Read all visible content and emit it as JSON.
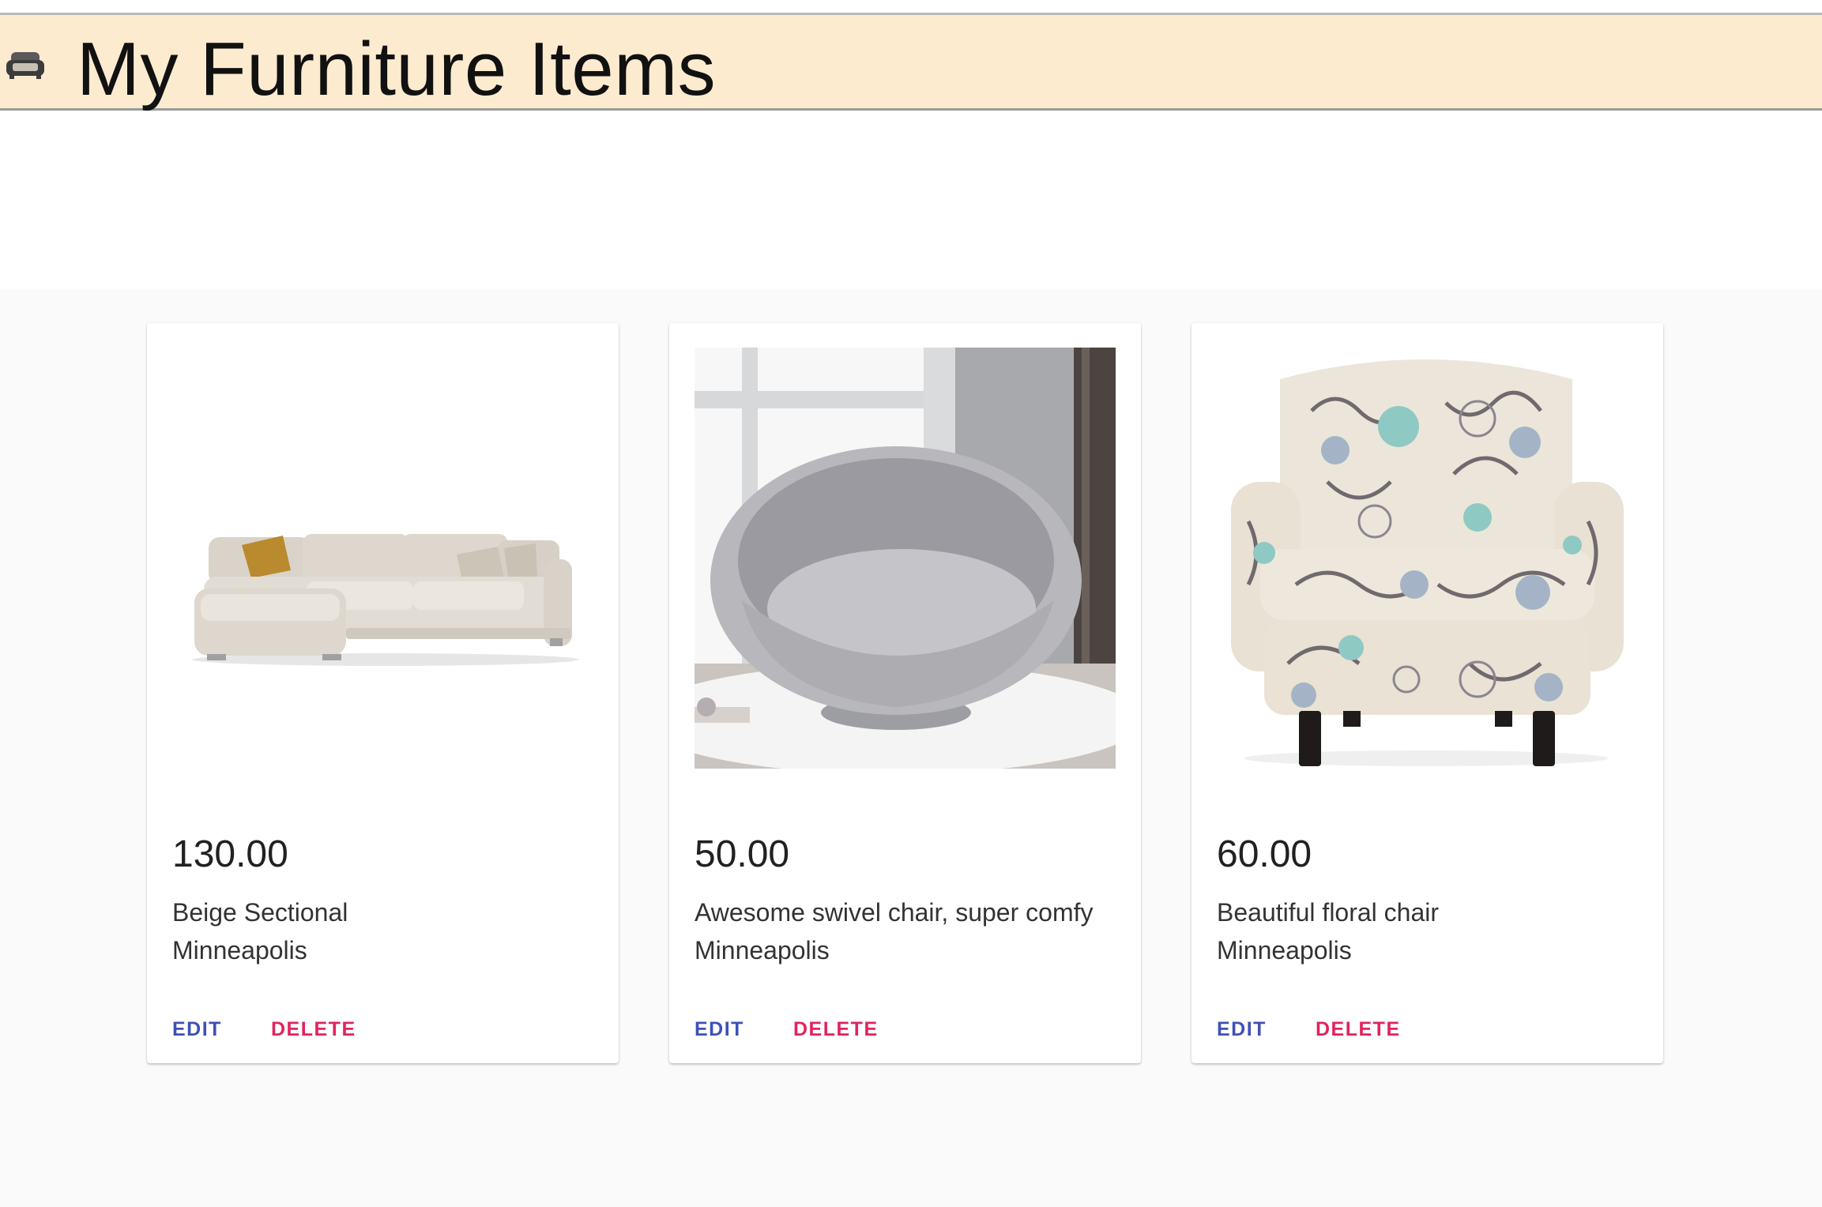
{
  "header": {
    "title": "My Furniture Items",
    "icon": "sofa-icon",
    "background": "#fdebd0"
  },
  "items": [
    {
      "price": "130.00",
      "description": "Beige Sectional",
      "location": "Minneapolis",
      "image": "beige-sectional-sofa",
      "edit_label": "EDIT",
      "delete_label": "DELETE"
    },
    {
      "price": "50.00",
      "description": "Awesome swivel chair, super comfy",
      "location": "Minneapolis",
      "image": "grey-swivel-chair",
      "edit_label": "EDIT",
      "delete_label": "DELETE"
    },
    {
      "price": "60.00",
      "description": "Beautiful floral chair",
      "location": "Minneapolis",
      "image": "floral-armchair",
      "edit_label": "EDIT",
      "delete_label": "DELETE"
    }
  ],
  "colors": {
    "edit": "#3f51b5",
    "delete": "#e0245e",
    "page_background": "#fafafa"
  }
}
